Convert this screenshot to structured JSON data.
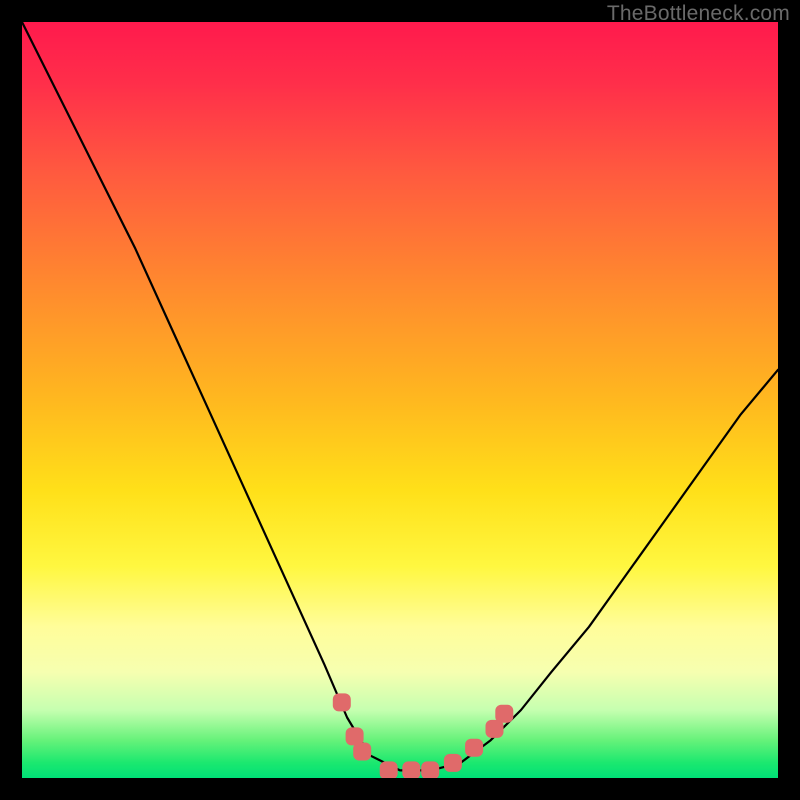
{
  "watermark": "TheBottleneck.com",
  "chart_data": {
    "type": "line",
    "title": "",
    "xlabel": "",
    "ylabel": "",
    "xlim": [
      0,
      100
    ],
    "ylim": [
      0,
      100
    ],
    "grid": false,
    "legend": false,
    "series": [
      {
        "name": "curve",
        "x": [
          0,
          5,
          10,
          15,
          20,
          25,
          30,
          35,
          40,
          43,
          46,
          50,
          54,
          58,
          62,
          66,
          70,
          75,
          80,
          85,
          90,
          95,
          100
        ],
        "values": [
          100,
          90,
          80,
          70,
          59,
          48,
          37,
          26,
          15,
          8,
          3,
          1,
          1,
          2,
          5,
          9,
          14,
          20,
          27,
          34,
          41,
          48,
          54
        ]
      }
    ],
    "markers": [
      {
        "x": 42.3,
        "y": 10.0
      },
      {
        "x": 44.0,
        "y": 5.5
      },
      {
        "x": 45.0,
        "y": 3.5
      },
      {
        "x": 48.5,
        "y": 1.0
      },
      {
        "x": 51.5,
        "y": 1.0
      },
      {
        "x": 54.0,
        "y": 1.0
      },
      {
        "x": 57.0,
        "y": 2.0
      },
      {
        "x": 59.8,
        "y": 4.0
      },
      {
        "x": 62.5,
        "y": 6.5
      },
      {
        "x": 63.8,
        "y": 8.5
      }
    ],
    "background_gradient": [
      {
        "stop": 0.0,
        "color": "#ff1a4d"
      },
      {
        "stop": 0.5,
        "color": "#ffb81f"
      },
      {
        "stop": 0.8,
        "color": "#fffd9a"
      },
      {
        "stop": 1.0,
        "color": "#00e077"
      }
    ]
  }
}
